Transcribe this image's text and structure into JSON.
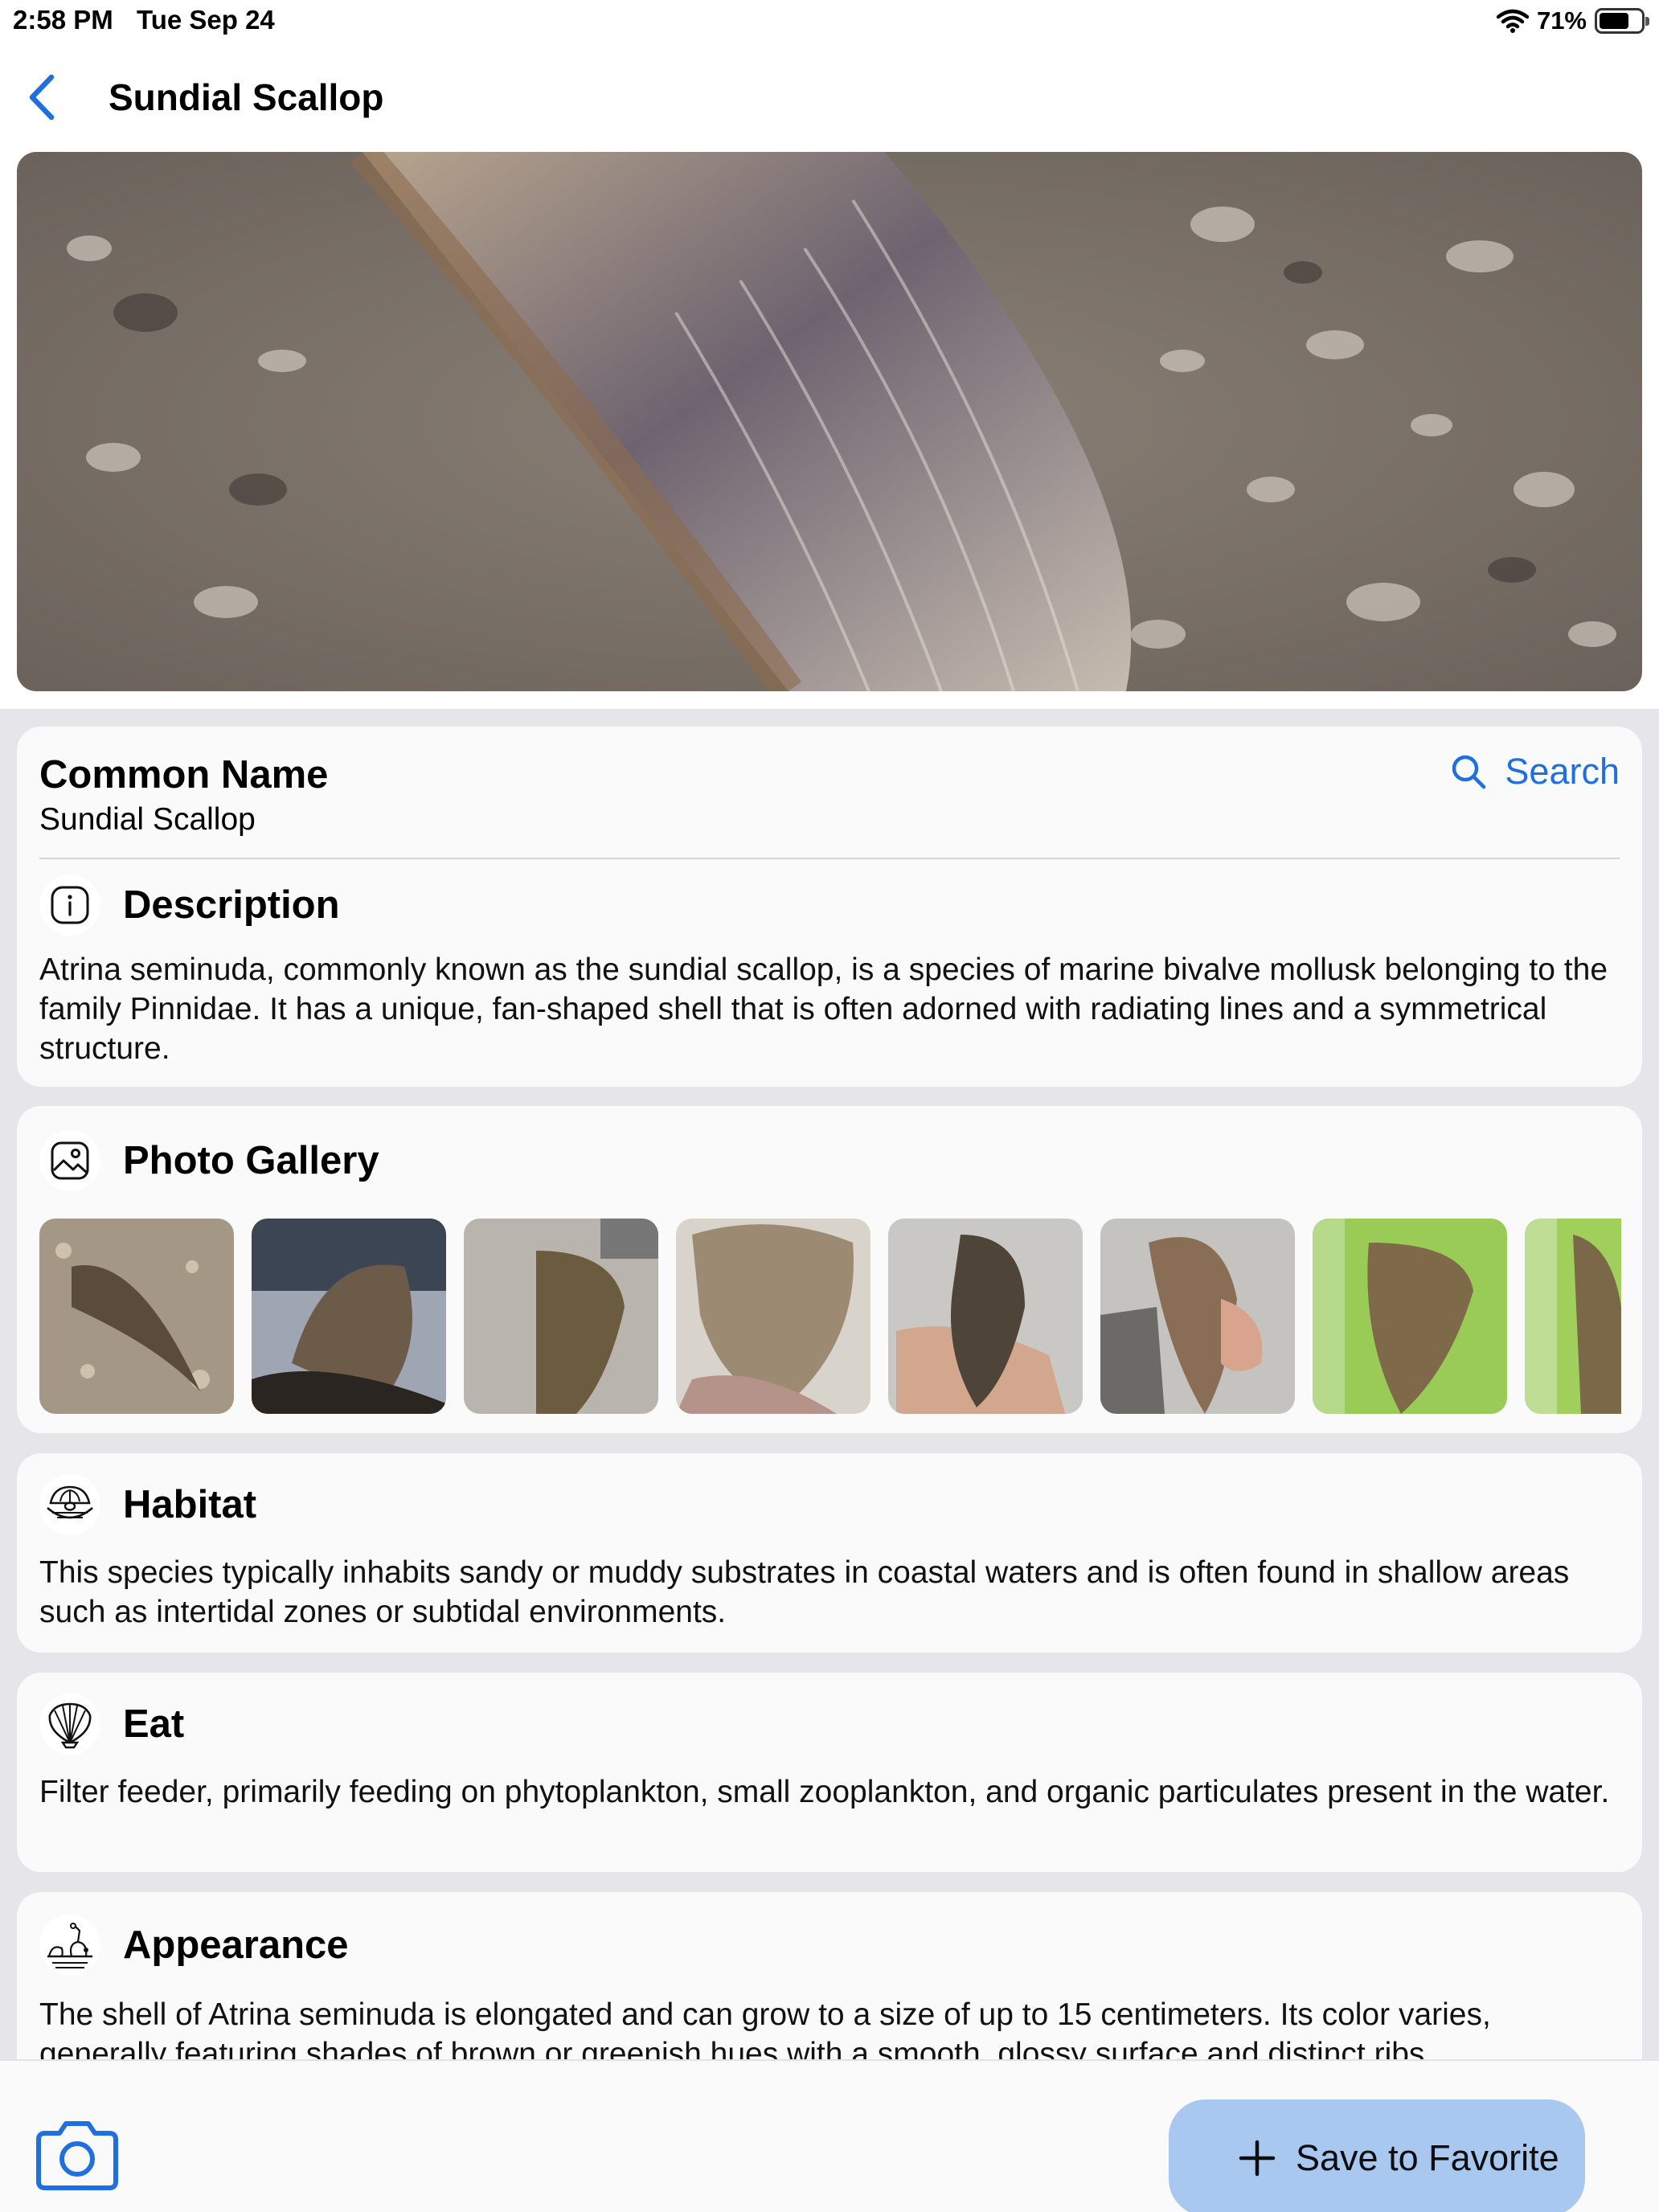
{
  "status_bar": {
    "time": "2:58 PM",
    "date": "Tue Sep 24",
    "battery": "71%",
    "battery_level": 0.71
  },
  "nav": {
    "title": "Sundial Scallop"
  },
  "common_name": {
    "label": "Common Name",
    "value": "Sundial Scallop",
    "search_label": "Search"
  },
  "description": {
    "title": "Description",
    "text": "Atrina seminuda, commonly known as the sundial scallop, is a species of marine bivalve mollusk belonging to the family Pinnidae. It has a unique, fan-shaped shell that is often adorned with radiating lines and a symmetrical structure."
  },
  "gallery": {
    "title": "Photo Gallery",
    "photo_count": 8
  },
  "habitat": {
    "title": "Habitat",
    "text": "This species typically inhabits sandy or muddy substrates in coastal waters and is often found in shallow areas such as intertidal zones or subtidal environments."
  },
  "eat": {
    "title": "Eat",
    "text": "Filter feeder, primarily feeding on phytoplankton, small zooplankton, and organic particulates present in the water."
  },
  "appearance": {
    "title": "Appearance",
    "text": "The shell of Atrina seminuda is elongated and can grow to a size of up to 15 centimeters. Its color varies, generally featuring shades of brown or greenish hues with a smooth, glossy surface and distinct ribs."
  },
  "bottom": {
    "save_label": "Save to Favorite"
  },
  "colors": {
    "accent": "#1f6fde",
    "save_button": "#a9c8f0",
    "page_background": "#e5e5ea",
    "card": "#fafafa"
  },
  "icons": [
    "chevron-left-icon",
    "wifi-icon",
    "battery-icon",
    "search-icon",
    "info-icon",
    "photo-icon",
    "clam-icon",
    "scallop-shell-icon",
    "appearance-icon",
    "camera-icon",
    "plus-icon"
  ]
}
